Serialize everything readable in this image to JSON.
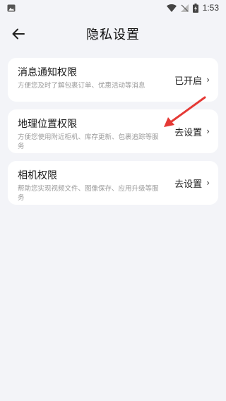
{
  "status_bar": {
    "time": "1:53"
  },
  "header": {
    "title": "隐私设置"
  },
  "permissions": [
    {
      "name": "消息通知权限",
      "desc": "方便您及时了解包裹订单、优惠活动等消息",
      "status": "已开启"
    },
    {
      "name": "地理位置权限",
      "desc": "方便您使用附近柜机、库存更新、包裹追踪等服务",
      "status": "去设置"
    },
    {
      "name": "相机权限",
      "desc": "帮助您实现视频文件、图像保存、应用升级等服务",
      "status": "去设置"
    }
  ],
  "colors": {
    "background": "#f3f4f8",
    "card": "#ffffff",
    "arrow": "#e53935",
    "chevron": "#2a7a6e"
  }
}
